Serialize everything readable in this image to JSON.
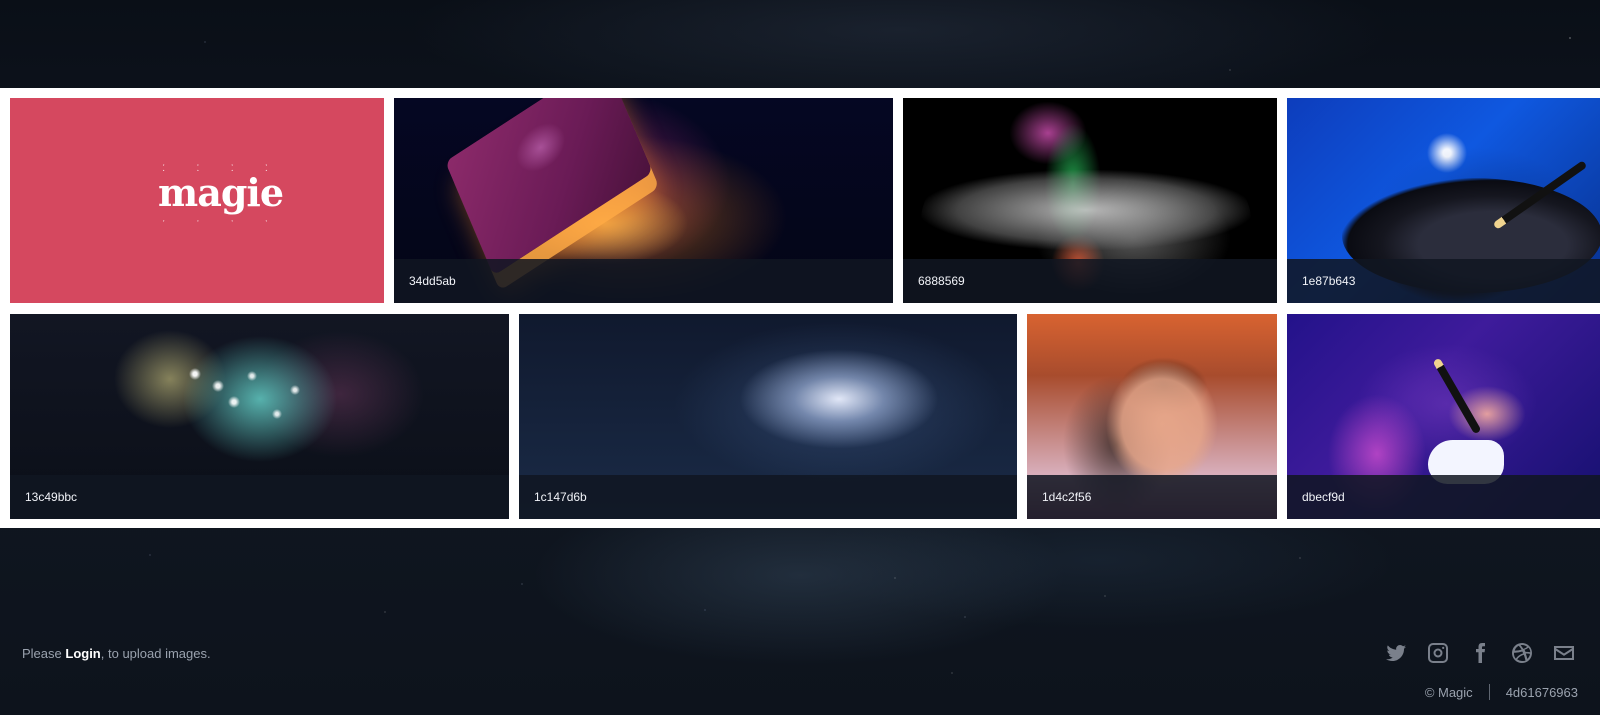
{
  "gallery": {
    "logo": {
      "name": "magie"
    },
    "items": [
      {
        "label": "34dd5ab"
      },
      {
        "label": "6888569"
      },
      {
        "label": "1e87b643"
      },
      {
        "label": "13c49bbc"
      },
      {
        "label": "1c147d6b"
      },
      {
        "label": "1d4c2f56"
      },
      {
        "label": "dbecf9d"
      }
    ]
  },
  "footer": {
    "please_text": "Please",
    "login_text": "Login",
    "upload_text": ", to upload images.",
    "social_icons": [
      "twitter-icon",
      "instagram-icon",
      "facebook-icon",
      "dribbble-icon",
      "envelope-icon"
    ],
    "copyright": "© Magic",
    "build_id": "4d61676963"
  },
  "colors": {
    "logo_tile": "#d5485f",
    "caption_bg": "#101622",
    "footer_text": "#9aa2ae",
    "icon": "#7a808b"
  }
}
